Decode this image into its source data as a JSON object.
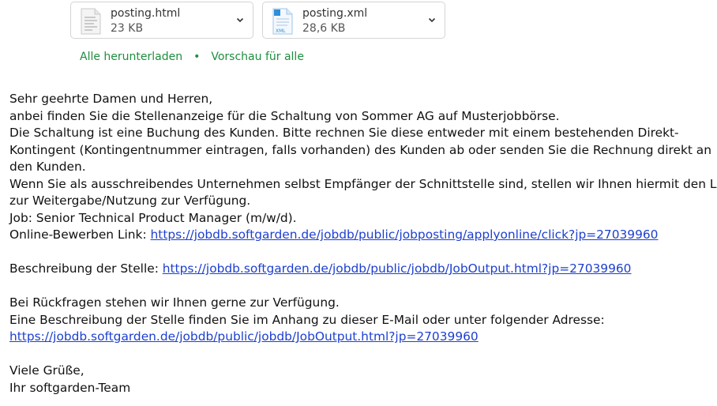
{
  "attachments": [
    {
      "name": "posting.html",
      "size": "23 KB",
      "icon": "html-file-icon"
    },
    {
      "name": "posting.xml",
      "size": "28,6 KB",
      "icon": "xml-file-icon",
      "icon_label": "XML"
    }
  ],
  "attachment_actions": {
    "download_all": "Alle herunterladen",
    "separator": "•",
    "preview_all": "Vorschau für alle"
  },
  "colors": {
    "action_green": "#1e8e3e",
    "link_blue": "#1c3fd0",
    "xml_icon_blue": "#2f8fd8"
  },
  "body": {
    "greeting": "Sehr geehrte Damen und Herren,",
    "intro": "anbei finden Sie die Stellenanzeige für die Schaltung von Sommer AG auf Musterjobbörse.",
    "para1_line1": "Die Schaltung ist eine Buchung des Kunden. Bitte rechnen Sie diese entweder mit einem bestehenden Direkt-",
    "para1_line2": "Kontingent (Kontingentnummer eintragen, falls vorhanden) des Kunden ab oder senden Sie die Rechnung direkt an",
    "para1_line3": "den Kunden.",
    "para2_line1": "Wenn Sie als ausschreibendes Unternehmen selbst Empfänger der Schnittstelle sind, stellen wir Ihnen hiermit den Link",
    "para2_line2": "zur Weitergabe/Nutzung zur Verfügung.",
    "job": "Job: Senior Technical Product Manager (m/w/d).",
    "apply_label": "Online-Bewerben Link: ",
    "apply_url": "https://jobdb.softgarden.de/jobdb/public/jobposting/applyonline/click?jp=27039960",
    "desc_label": "Beschreibung der Stelle: ",
    "desc_url": "https://jobdb.softgarden.de/jobdb/public/jobdb/JobOutput.html?jp=27039960",
    "questions": "Bei Rückfragen stehen wir Ihnen gerne zur Verfügung.",
    "attachment_note": "Eine Beschreibung der Stelle finden Sie im Anhang zu dieser E-Mail oder unter folgender Adresse:",
    "desc_url2": "https://jobdb.softgarden.de/jobdb/public/jobdb/JobOutput.html?jp=27039960",
    "closing": "Viele Grüße,",
    "signature": "Ihr softgarden-Team"
  }
}
